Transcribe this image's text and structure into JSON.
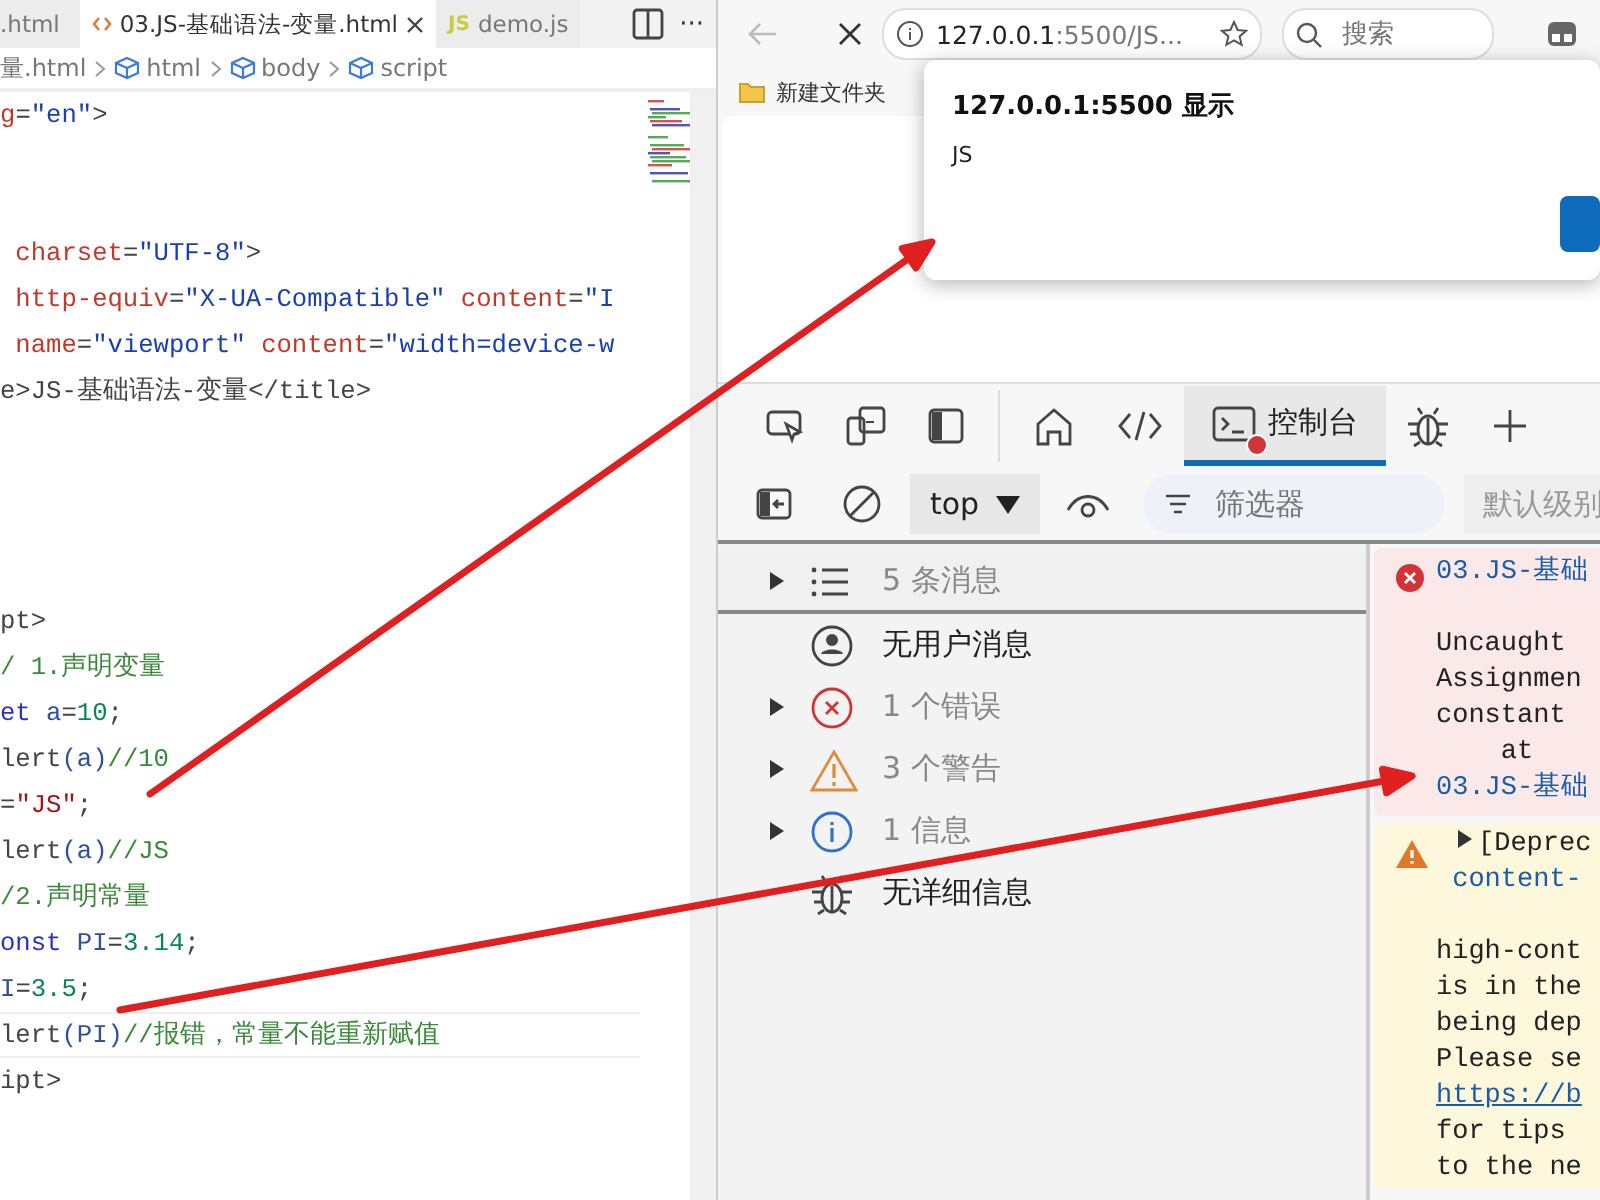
{
  "editor": {
    "tabs": [
      {
        "label": ".html",
        "selected": false
      },
      {
        "label": "03.JS-基础语法-变量.html",
        "selected": true
      },
      {
        "label": "demo.js",
        "icon_text": "JS",
        "selected": false
      }
    ],
    "more": "···",
    "breadcrumbs": [
      {
        "label": "量.html"
      },
      {
        "label": "html"
      },
      {
        "label": "body"
      },
      {
        "label": "script"
      }
    ],
    "lines": [
      {
        "kind": "code",
        "current": false,
        "tokens": [
          {
            "kind": "attr",
            "text": "g"
          },
          {
            "kind": "plain",
            "text": "="
          },
          {
            "kind": "string",
            "text": "\"en\""
          },
          {
            "kind": "plain",
            "text": ">"
          }
        ]
      },
      {
        "kind": "blank",
        "current": false
      },
      {
        "kind": "blank",
        "current": false
      },
      {
        "kind": "code",
        "current": false,
        "tokens": [
          {
            "kind": "attr",
            "text": " charset"
          },
          {
            "kind": "plain",
            "text": "="
          },
          {
            "kind": "string",
            "text": "\"UTF-8\""
          },
          {
            "kind": "plain",
            "text": ">"
          }
        ]
      },
      {
        "kind": "code",
        "current": false,
        "tokens": [
          {
            "kind": "attr",
            "text": " http-equiv"
          },
          {
            "kind": "plain",
            "text": "="
          },
          {
            "kind": "string",
            "text": "\"X-UA-Compatible\""
          },
          {
            "kind": "attr",
            "text": " content"
          },
          {
            "kind": "plain",
            "text": "="
          },
          {
            "kind": "string",
            "text": "\"I"
          }
        ]
      },
      {
        "kind": "code",
        "current": false,
        "tokens": [
          {
            "kind": "attr",
            "text": " name"
          },
          {
            "kind": "plain",
            "text": "="
          },
          {
            "kind": "string",
            "text": "\"viewport\""
          },
          {
            "kind": "attr",
            "text": " content"
          },
          {
            "kind": "plain",
            "text": "="
          },
          {
            "kind": "string",
            "text": "\"width=device-w"
          }
        ]
      },
      {
        "kind": "code",
        "current": false,
        "tokens": [
          {
            "kind": "plain",
            "text": "e>JS-基础语法-变量</title>"
          }
        ]
      },
      {
        "kind": "blank",
        "current": false
      },
      {
        "kind": "blank",
        "current": false
      },
      {
        "kind": "blank",
        "current": false
      },
      {
        "kind": "blank",
        "current": false
      },
      {
        "kind": "code",
        "current": false,
        "tokens": [
          {
            "kind": "plain",
            "text": "pt>"
          }
        ]
      },
      {
        "kind": "code",
        "current": false,
        "tokens": [
          {
            "kind": "comment",
            "text": "/ 1.声明变量"
          }
        ]
      },
      {
        "kind": "code",
        "current": false,
        "tokens": [
          {
            "kind": "keyword",
            "text": "et"
          },
          {
            "kind": "var",
            "text": " a"
          },
          {
            "kind": "plain",
            "text": "="
          },
          {
            "kind": "number",
            "text": "10"
          },
          {
            "kind": "plain",
            "text": ";"
          }
        ]
      },
      {
        "kind": "code",
        "current": false,
        "tokens": [
          {
            "kind": "plain",
            "text": "lert"
          },
          {
            "kind": "var",
            "text": "(a)"
          },
          {
            "kind": "comment",
            "text": "//10"
          }
        ]
      },
      {
        "kind": "code",
        "current": false,
        "tokens": [
          {
            "kind": "plain",
            "text": "="
          },
          {
            "kind": "jsstring",
            "text": "\"JS\""
          },
          {
            "kind": "plain",
            "text": ";"
          }
        ]
      },
      {
        "kind": "code",
        "current": false,
        "tokens": [
          {
            "kind": "plain",
            "text": "lert"
          },
          {
            "kind": "var",
            "text": "(a)"
          },
          {
            "kind": "comment",
            "text": "//JS"
          }
        ]
      },
      {
        "kind": "code",
        "current": false,
        "tokens": [
          {
            "kind": "comment",
            "text": "/2.声明常量"
          }
        ]
      },
      {
        "kind": "code",
        "current": false,
        "tokens": [
          {
            "kind": "keyword",
            "text": "onst"
          },
          {
            "kind": "var",
            "text": " PI"
          },
          {
            "kind": "plain",
            "text": "="
          },
          {
            "kind": "number",
            "text": "3.14"
          },
          {
            "kind": "plain",
            "text": ";"
          }
        ]
      },
      {
        "kind": "code",
        "current": false,
        "tokens": [
          {
            "kind": "var",
            "text": "I"
          },
          {
            "kind": "plain",
            "text": "="
          },
          {
            "kind": "number",
            "text": "3.5"
          },
          {
            "kind": "plain",
            "text": ";"
          }
        ]
      },
      {
        "kind": "code",
        "current": true,
        "tokens": [
          {
            "kind": "plain",
            "text": "lert"
          },
          {
            "kind": "var",
            "text": "(PI)"
          },
          {
            "kind": "comment",
            "text": "//报错，常量不能重新赋值"
          }
        ]
      },
      {
        "kind": "code",
        "current": false,
        "tokens": [
          {
            "kind": "plain",
            "text": "ipt>"
          }
        ]
      }
    ]
  },
  "browser": {
    "address": {
      "host": "127.0.0.1",
      "rest": ":5500/JS..."
    },
    "search": {
      "placeholder": "搜索"
    },
    "bookmarks": [
      {
        "label": "新建文件夹"
      }
    ],
    "dialog": {
      "title": "127.0.0.1:5500 显示",
      "message": "JS"
    },
    "devtools": {
      "tabs": [
        {
          "kind": "home",
          "selected": false
        },
        {
          "kind": "elements",
          "selected": false
        },
        {
          "kind": "console",
          "label": "控制台",
          "selected": true,
          "error_badge": true
        },
        {
          "kind": "bug",
          "selected": false
        }
      ],
      "context": "top",
      "filter": {
        "placeholder": "筛选器"
      },
      "levels": "默认级别",
      "sidebar": [
        {
          "kind": "list",
          "label": "5 条消息",
          "expandable": true,
          "dimmed": true,
          "selected": true
        },
        {
          "kind": "user",
          "label": "无用户消息",
          "expandable": false,
          "dimmed": false,
          "selected": false
        },
        {
          "kind": "error",
          "label": "1 个错误",
          "expandable": true,
          "dimmed": true,
          "selected": false
        },
        {
          "kind": "warning",
          "label": "3 个警告",
          "expandable": true,
          "dimmed": true,
          "selected": false
        },
        {
          "kind": "info",
          "label": "1 信息",
          "expandable": true,
          "dimmed": true,
          "selected": false
        },
        {
          "kind": "bug",
          "label": "无详细信息",
          "expandable": false,
          "dimmed": false,
          "selected": false
        }
      ],
      "messages": [
        {
          "kind": "error",
          "lines": [
            {
              "kind": "source",
              "text": "03.JS-基础"
            },
            {
              "kind": "blank"
            },
            {
              "kind": "text",
              "text": "Uncaught"
            },
            {
              "kind": "text",
              "text": "Assignmen"
            },
            {
              "kind": "text",
              "text": "constant"
            },
            {
              "kind": "text",
              "text": "    at"
            },
            {
              "kind": "source",
              "text": "03.JS-基础"
            }
          ]
        },
        {
          "kind": "warning",
          "lines": [
            {
              "kind": "summary",
              "text": "[Deprec"
            },
            {
              "kind": "source",
              "text": " content-"
            },
            {
              "kind": "blank"
            },
            {
              "kind": "text",
              "text": "high-cont"
            },
            {
              "kind": "text",
              "text": "is in the"
            },
            {
              "kind": "text",
              "text": "being dep"
            },
            {
              "kind": "text",
              "text": "Please se"
            },
            {
              "kind": "link",
              "text": "https://b"
            },
            {
              "kind": "text",
              "text": "for tips"
            },
            {
              "kind": "text",
              "text": "to the ne"
            }
          ]
        }
      ]
    }
  }
}
